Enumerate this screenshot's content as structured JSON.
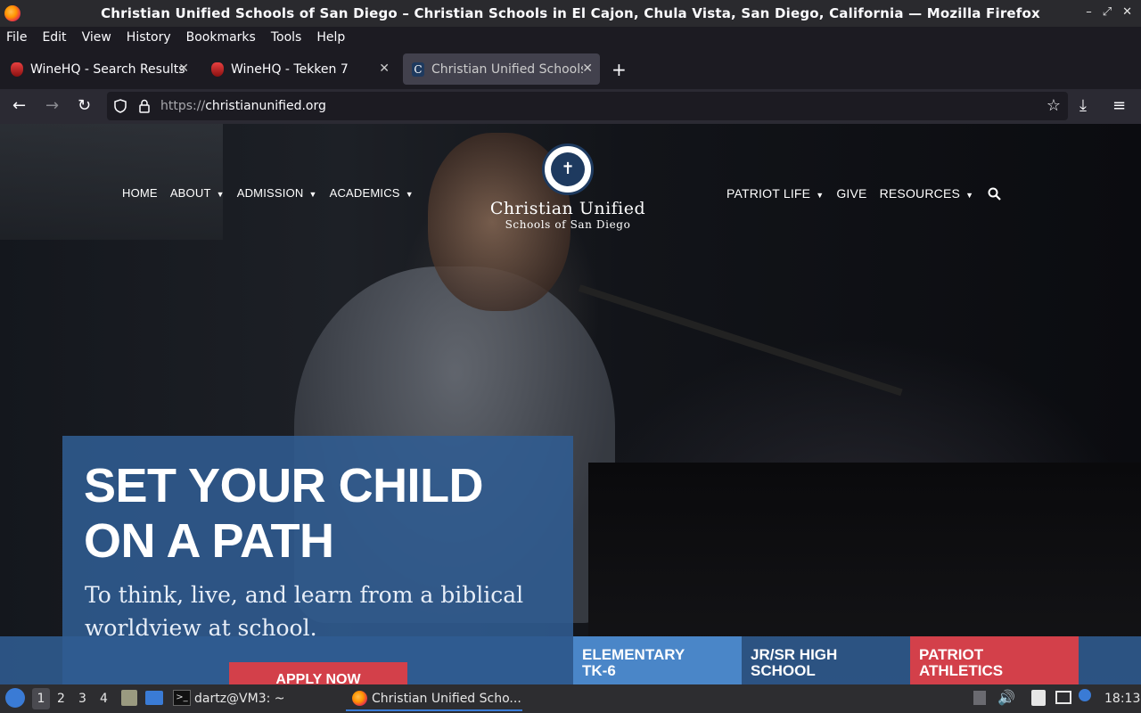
{
  "window": {
    "title": "Christian Unified Schools of San Diego – Christian Schools in El Cajon, Chula Vista, San Diego, California — Mozilla Firefox",
    "controls": [
      "–",
      "⤢",
      "✕"
    ]
  },
  "menu": [
    "File",
    "Edit",
    "View",
    "History",
    "Bookmarks",
    "Tools",
    "Help"
  ],
  "tabs": [
    {
      "label": "WineHQ - Search Results",
      "icon": "wine-icon"
    },
    {
      "label": "WineHQ - Tekken 7",
      "icon": "wine-icon"
    },
    {
      "label": "Christian Unified Schools",
      "icon": "cu-icon",
      "active": true
    }
  ],
  "newtab": "+",
  "nav": {
    "url_prefix": "https://",
    "url_host": "christianunified.org"
  },
  "site": {
    "nav_left": [
      {
        "label": "HOME",
        "caret": false
      },
      {
        "label": "ABOUT",
        "caret": true
      },
      {
        "label": "ADMISSION",
        "caret": true
      },
      {
        "label": "ACADEMICS",
        "caret": true
      }
    ],
    "nav_right": [
      {
        "label": "PATRIOT LIFE",
        "caret": true
      },
      {
        "label": "GIVE",
        "caret": false
      },
      {
        "label": "RESOURCES",
        "caret": true
      }
    ],
    "logo_name": "Christian Unified",
    "logo_sub": "Schools of San Diego",
    "headline_1": "SET YOUR CHILD",
    "headline_2": "ON A PATH",
    "subline": "To think, live, and learn from a biblical worldview at school.",
    "apply_label": "APPLY NOW",
    "levels": [
      {
        "line1": "ELEMENTARY",
        "line2": "TK-6",
        "color": "#4a86c8"
      },
      {
        "line1": "JR/SR HIGH",
        "line2": "SCHOOL",
        "color": "#305c92"
      },
      {
        "line1": "PATRIOT",
        "line2": "ATHLETICS",
        "color": "#d3404a"
      }
    ],
    "colors": {
      "hero_blue": "#305c92",
      "accent_red": "#d3404a",
      "elementary_blue": "#4a86c8"
    }
  },
  "taskbar": {
    "workspaces": [
      "1",
      "2",
      "3",
      "4"
    ],
    "terminal": "dartz@VM3: ~",
    "firefox": "Christian Unified Scho...",
    "clock": "18:13"
  }
}
